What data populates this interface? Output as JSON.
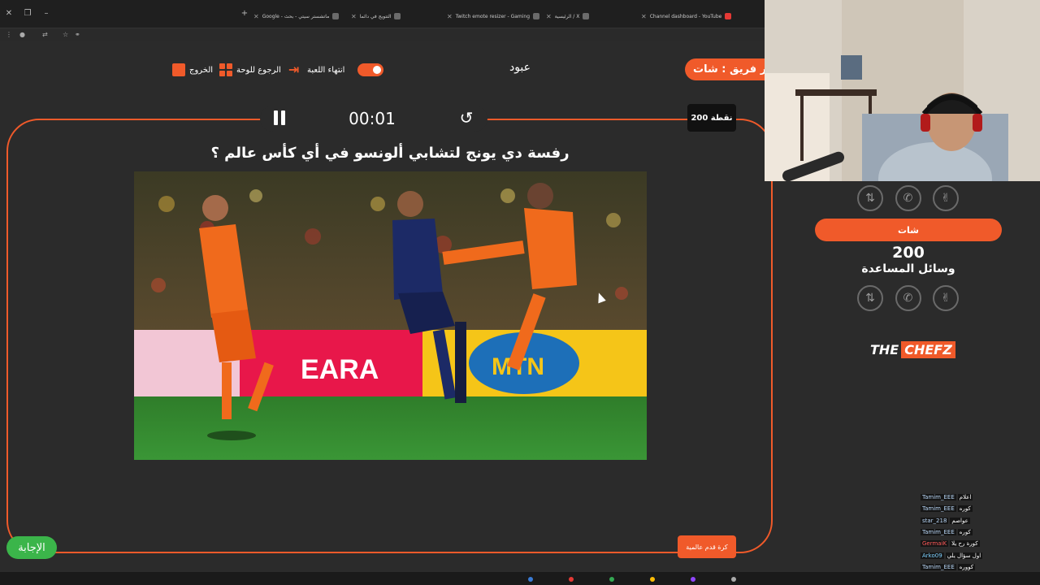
{
  "browser": {
    "tabs": [
      {
        "label": "Google - ماتشستر سيتي - بحث"
      },
      {
        "label": "التتويج في دائما"
      },
      {
        "label": "Twitch emote resizer - Gaming"
      },
      {
        "label": "الرئيسية / X"
      },
      {
        "label": "Channel dashboard - YouTube"
      }
    ]
  },
  "header": {
    "exit_label": "الخروج",
    "back_label": "الرجوع للوحة",
    "end_game_label": "انتهاء اللعبة",
    "player_name": "عبود",
    "team_turn": "دور فريق : شات"
  },
  "question_panel": {
    "timer": "00:01",
    "points": "200 نقطة",
    "question": "رفسة دي يونج لتشابي ألونسو في أي كأس عالم ؟",
    "answer_button": "الإجابة",
    "category": "كرة قدم عالمية"
  },
  "side_panel": {
    "team_name": "شات",
    "score": "200",
    "help_label": "وسائل المساعدة",
    "logo_part1": "THE",
    "logo_part2": "CHEFZ"
  },
  "icons": {
    "help_tools": [
      "swap-icon",
      "phone-icon",
      "hand-icon"
    ]
  },
  "chat": [
    {
      "user": "Tamim_EEE",
      "message": "اعلام"
    },
    {
      "user": "Tamim_EEE",
      "message": "كوره"
    },
    {
      "user": "star_218",
      "message": "عواصم"
    },
    {
      "user": "Tamim_EEE",
      "message": "كوره"
    },
    {
      "user": "GermaiK",
      "message": "كورة رح يلا"
    },
    {
      "user": "Arko09",
      "message": "اول سؤال يلي"
    },
    {
      "user": "Tamim_EEE",
      "message": "كووره"
    }
  ],
  "colors": {
    "accent": "#f05a2a",
    "answer_green": "#3bb54a",
    "background": "#2b2b2b"
  }
}
